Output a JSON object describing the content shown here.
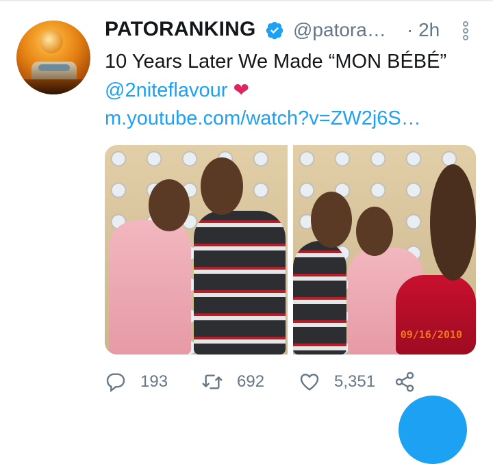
{
  "tweet": {
    "author_name": "PATORANKING",
    "handle": "@patora…",
    "separator": "·",
    "time": "2h",
    "text_part1": "10 Years Later We Made “MON BÉBÉ” ",
    "mention": "@2niteflavour",
    "emoji": "❤",
    "link": "m.youtube.com/watch?v=ZW2j6S…",
    "photo_datestamp": "09/16/2010"
  },
  "actions": {
    "reply_count": "193",
    "retweet_count": "692",
    "like_count": "5,351"
  },
  "colors": {
    "link": "#1da1f2",
    "muted": "#657786",
    "verified": "#1da1f2",
    "heart": "#e0245e"
  },
  "icons": {
    "verified": "verified-badge-icon",
    "more": "more-options-icon",
    "reply": "reply-icon",
    "retweet": "retweet-icon",
    "like": "like-icon",
    "share": "share-icon"
  }
}
